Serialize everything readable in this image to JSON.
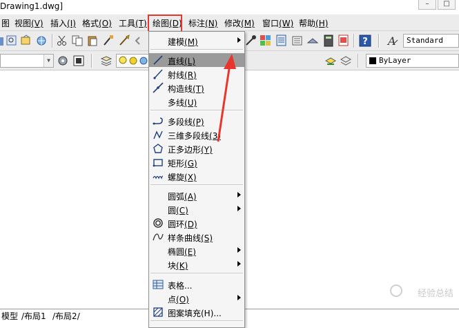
{
  "window": {
    "title": "Drawing1.dwg]",
    "minimize_glyph": "–",
    "maximize_glyph": "□"
  },
  "menubar": {
    "items": [
      {
        "label": "图",
        "key": ""
      },
      {
        "label": "视图",
        "key": "(V)"
      },
      {
        "label": "插入",
        "key": "(I)"
      },
      {
        "label": "格式",
        "key": "(O)"
      },
      {
        "label": "工具",
        "key": "(T)"
      },
      {
        "label": "绘图",
        "key": "(D)"
      },
      {
        "label": "标注",
        "key": "(N)"
      },
      {
        "label": "修改",
        "key": "(M)"
      },
      {
        "label": "窗口",
        "key": "(W)"
      },
      {
        "label": "帮助",
        "key": "(H)"
      }
    ],
    "highlight_color": "#e8362e"
  },
  "toolbar": {
    "text_style": "Standard",
    "layer": "ByLayer"
  },
  "tabs": [
    "模型",
    "布局1",
    "布局2"
  ],
  "watermark": "经验总结",
  "draw_menu": {
    "items": [
      {
        "label": "建模",
        "key": "(M)",
        "submenu": true,
        "icon": ""
      },
      {
        "sep": true
      },
      {
        "label": "直线",
        "key": "(L)",
        "active": true,
        "icon": "line-icon"
      },
      {
        "label": "射线",
        "key": "(R)",
        "icon": "ray-icon"
      },
      {
        "label": "构造线",
        "key": "(T)",
        "icon": "xline-icon"
      },
      {
        "label": "多线",
        "key": "(U)",
        "icon": ""
      },
      {
        "sep": true
      },
      {
        "label": "多段线",
        "key": "(P)",
        "icon": "polyline-icon"
      },
      {
        "label": "三维多段线",
        "key": "(3)",
        "icon": "3d-polyline-icon"
      },
      {
        "label": "正多边形",
        "key": "(Y)",
        "icon": "polygon-icon"
      },
      {
        "label": "矩形",
        "key": "(G)",
        "icon": "rectangle-icon"
      },
      {
        "label": "螺旋",
        "key": "(X)",
        "icon": "helix-icon"
      },
      {
        "sep": true
      },
      {
        "label": "圆弧",
        "key": "(A)",
        "submenu": true,
        "icon": ""
      },
      {
        "label": "圆",
        "key": "(C)",
        "submenu": true,
        "icon": ""
      },
      {
        "label": "圆环",
        "key": "(D)",
        "icon": "donut-icon"
      },
      {
        "label": "样条曲线",
        "key": "(S)",
        "icon": "spline-icon"
      },
      {
        "label": "椭圆",
        "key": "(E)",
        "submenu": true,
        "icon": ""
      },
      {
        "label": "块",
        "key": "(K)",
        "submenu": true,
        "icon": ""
      },
      {
        "sep": true
      },
      {
        "label": "表格...",
        "key": "",
        "icon": "table-icon"
      },
      {
        "label": "点",
        "key": "(O)",
        "submenu": true,
        "icon": ""
      },
      {
        "label": "图案填充(H)...",
        "key": "",
        "icon": "hatch-icon"
      }
    ],
    "active_color": "#9a9a9a"
  },
  "annotation_color": "#e8362e"
}
